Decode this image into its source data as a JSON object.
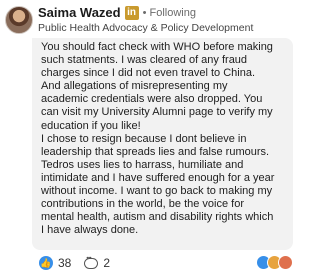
{
  "author": {
    "name": "Saima Wazed",
    "badge": "in",
    "follow_status": "• Following",
    "headline": "Public Health Advocacy & Policy Development"
  },
  "comment": {
    "lines": [
      "You should fact check with WHO before making",
      "such statments. I was cleared of any fraud",
      "charges since I  did not even travel to China.",
      "And allegations of misrepresenting my",
      "academic credentials were also dropped. You",
      "can visit my University Alumni page to verify my",
      "education if you like!",
      "I chose to resign because I dont believe in",
      "leadership that spreads lies and false rumours.",
      "Tedros uses lies to harrass,  humiliate and",
      "intimidate and I have suffered enough for a year",
      "without income. I want to go back to making my",
      "contributions in the world, be the voice for",
      "mental health, autism and disability rights which",
      "I have always done."
    ]
  },
  "footer": {
    "reaction_count": "38",
    "reply_count": "2"
  },
  "icons": {
    "reaction": "like-icon",
    "reply": "comment-icon",
    "stack": [
      "like-icon",
      "celebrate-icon",
      "support-icon"
    ]
  },
  "colors": {
    "accent_blue": "#378fe9",
    "bubble_bg": "#f2f2f2",
    "badge_gold": "#c99a2e"
  }
}
